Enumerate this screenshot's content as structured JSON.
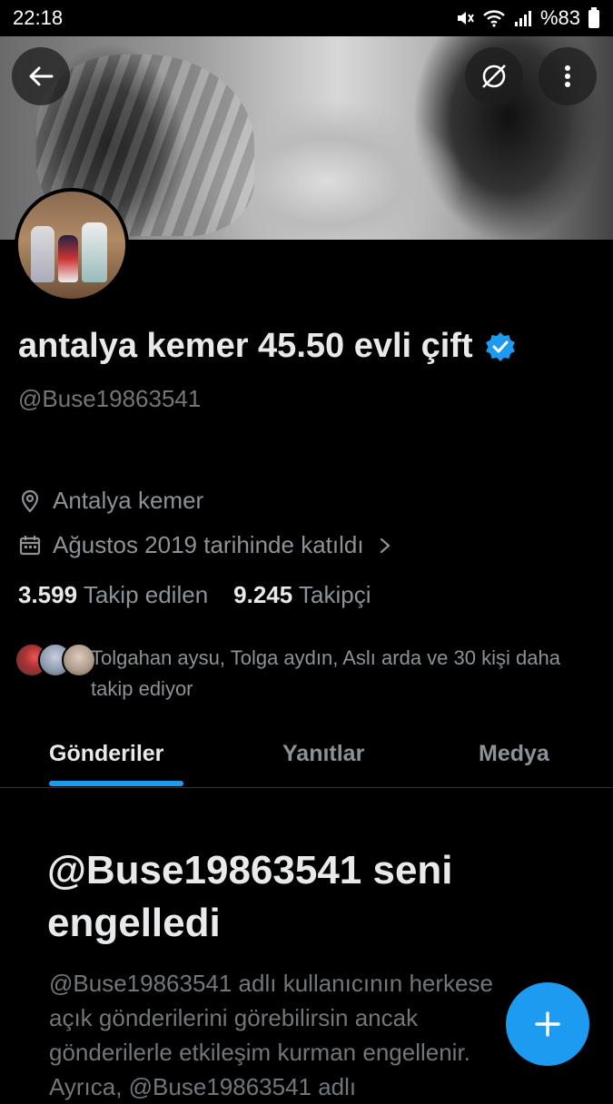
{
  "status_bar": {
    "time": "22:18",
    "battery": "%83"
  },
  "profile": {
    "name": "antalya kemer 45.50 evli çift",
    "handle": "@Buse19863541",
    "location": "Antalya kemer",
    "joined": "Ağustos 2019 tarihinde katıldı",
    "following_count": "3.599",
    "following_label": "Takip edilen",
    "followers_count": "9.245",
    "followers_label": "Takipçi",
    "followed_by_text": "Tolgahan aysu, Tolga aydın, Aslı arda ve 30 kişi daha takip ediyor"
  },
  "tabs": [
    {
      "label": "Gönderiler",
      "active": true
    },
    {
      "label": "Yanıtlar",
      "active": false
    },
    {
      "label": "Medya",
      "active": false
    }
  ],
  "blocked": {
    "title": "@Buse19863541 seni engelledi",
    "body": "@Buse19863541 adlı kullanıcının herkese açık gönderilerini görebilirsin ancak gönderilerle etkileşim kurman engellenir. Ayrıca, @Buse19863541 adlı"
  },
  "icons": {
    "back": "arrow-left-icon",
    "grok": "grok-icon",
    "more": "more-vertical-icon",
    "verified": "verified-badge-icon",
    "location": "location-pin-icon",
    "calendar": "calendar-icon",
    "chevron": "chevron-right-icon",
    "compose": "plus-icon"
  },
  "colors": {
    "accent": "#1d9bf0",
    "background": "#000000",
    "text_primary": "#e7e9ea",
    "text_secondary": "#71767b"
  }
}
